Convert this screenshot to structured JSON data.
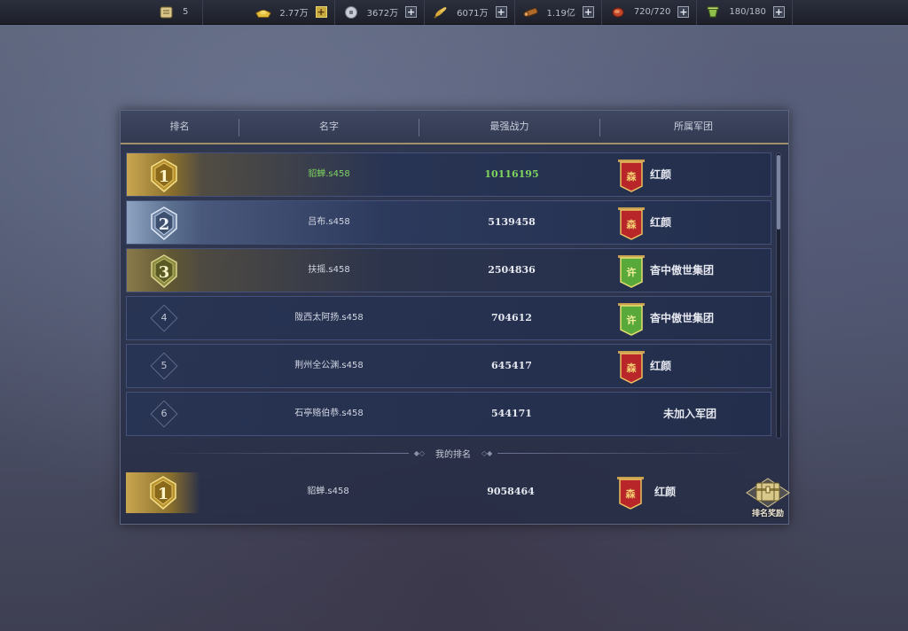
{
  "topbar": {
    "resources": [
      {
        "icon": "scroll-icon",
        "value": "5",
        "has_plus": false
      },
      {
        "icon": "gold-ingot-icon",
        "value": "2.77万",
        "has_plus": true,
        "plus_style": "gold"
      },
      {
        "icon": "silver-coin-icon",
        "value": "3672万",
        "has_plus": true
      },
      {
        "icon": "grain-icon",
        "value": "6071万",
        "has_plus": true
      },
      {
        "icon": "wood-icon",
        "value": "1.19亿",
        "has_plus": true
      },
      {
        "icon": "stamina-meat-icon",
        "value": "720/720",
        "has_plus": true
      },
      {
        "icon": "energy-cup-icon",
        "value": "180/180",
        "has_plus": true
      }
    ]
  },
  "ranking": {
    "headers": {
      "rank": "排名",
      "name": "名字",
      "power": "最强战力",
      "legion": "所属军团"
    },
    "rows": [
      {
        "rank": "1",
        "name": "貂蝉.s458",
        "power": "10116195",
        "legion": "红颜",
        "banner": "red",
        "banner_glyph": "森"
      },
      {
        "rank": "2",
        "name": "吕布.s458",
        "power": "5139458",
        "legion": "红颜",
        "banner": "red",
        "banner_glyph": "森"
      },
      {
        "rank": "3",
        "name": "扶摇.s458",
        "power": "2504836",
        "legion": "杳中傲世集团",
        "banner": "green",
        "banner_glyph": "许"
      },
      {
        "rank": "4",
        "name": "陇西太阿扬.s458",
        "power": "704612",
        "legion": "杳中傲世集团",
        "banner": "green",
        "banner_glyph": "许"
      },
      {
        "rank": "5",
        "name": "荆州全公渊.s458",
        "power": "645417",
        "legion": "红颜",
        "banner": "red",
        "banner_glyph": "森"
      },
      {
        "rank": "6",
        "name": "石亭赂伯恭.s458",
        "power": "544171",
        "legion": "未加入军团",
        "banner": "none",
        "banner_glyph": ""
      }
    ],
    "my_rank_label": "我的排名",
    "my_rank": {
      "rank": "1",
      "name": "貂蝉.s458",
      "power": "9058464",
      "legion": "红颜",
      "banner": "red",
      "banner_glyph": "森"
    },
    "reward_button_label": "排名奖励",
    "scroll_position": 0.0
  },
  "colors": {
    "gold": "#c9a650",
    "silver": "#8ea3c0",
    "bronze": "#8a7a4a",
    "highlight_green": "#7fd35f",
    "banner_red": "#b8262a",
    "banner_green": "#58a83a"
  }
}
